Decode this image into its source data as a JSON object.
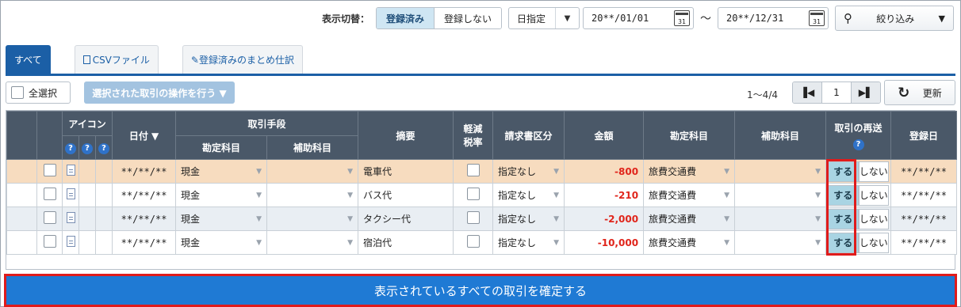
{
  "filter": {
    "toggle_label": "表示切替：",
    "seg_registered": "登録済み",
    "seg_unregistered": "登録しない",
    "date_mode": "日指定",
    "date_from": "20**/01/01",
    "date_to": "20**/12/31",
    "tilde": "～",
    "filter_label": "絞り込み"
  },
  "tabs": {
    "all": "すべて",
    "csv": "CSVファイル",
    "summary": "登録済みのまとめ仕訳"
  },
  "toolbar": {
    "select_all": "全選択",
    "operate": "選択された取引の操作を行う ▼",
    "range": "1～4/4",
    "page": "1",
    "refresh": "更新"
  },
  "table": {
    "headers": {
      "icon": "アイコン",
      "date": "日付 ▼",
      "method": "取引手段",
      "method_account": "勘定科目",
      "method_sub": "補助科目",
      "summary": "摘要",
      "reduced_1": "軽減",
      "reduced_2": "税率",
      "invoice": "請求書区分",
      "amount": "金額",
      "account": "勘定科目",
      "sub_account": "補助科目",
      "resend": "取引の再送",
      "registered": "登録日"
    },
    "rows": [
      {
        "date": "**/**/**",
        "method": "現金",
        "summary": "電車代",
        "invoice": "指定なし",
        "amount": "-800",
        "account": "旅費交通費",
        "yes": "する",
        "no": "しない",
        "reg": "**/**/**"
      },
      {
        "date": "**/**/**",
        "method": "現金",
        "summary": "バス代",
        "invoice": "指定なし",
        "amount": "-210",
        "account": "旅費交通費",
        "yes": "する",
        "no": "しない",
        "reg": "**/**/**"
      },
      {
        "date": "**/**/**",
        "method": "現金",
        "summary": "タクシー代",
        "invoice": "指定なし",
        "amount": "-2,000",
        "account": "旅費交通費",
        "yes": "する",
        "no": "しない",
        "reg": "**/**/**"
      },
      {
        "date": "**/**/**",
        "method": "現金",
        "summary": "宿泊代",
        "invoice": "指定なし",
        "amount": "-10,000",
        "account": "旅費交通費",
        "yes": "する",
        "no": "しない",
        "reg": "**/**/**"
      }
    ]
  },
  "confirm_label": "表示されているすべての取引を確定する",
  "colors": {
    "accent": "#1b5fa6",
    "confirm": "#1f7ad4",
    "highlight": "#e01b1b",
    "amount": "#e0251b"
  }
}
